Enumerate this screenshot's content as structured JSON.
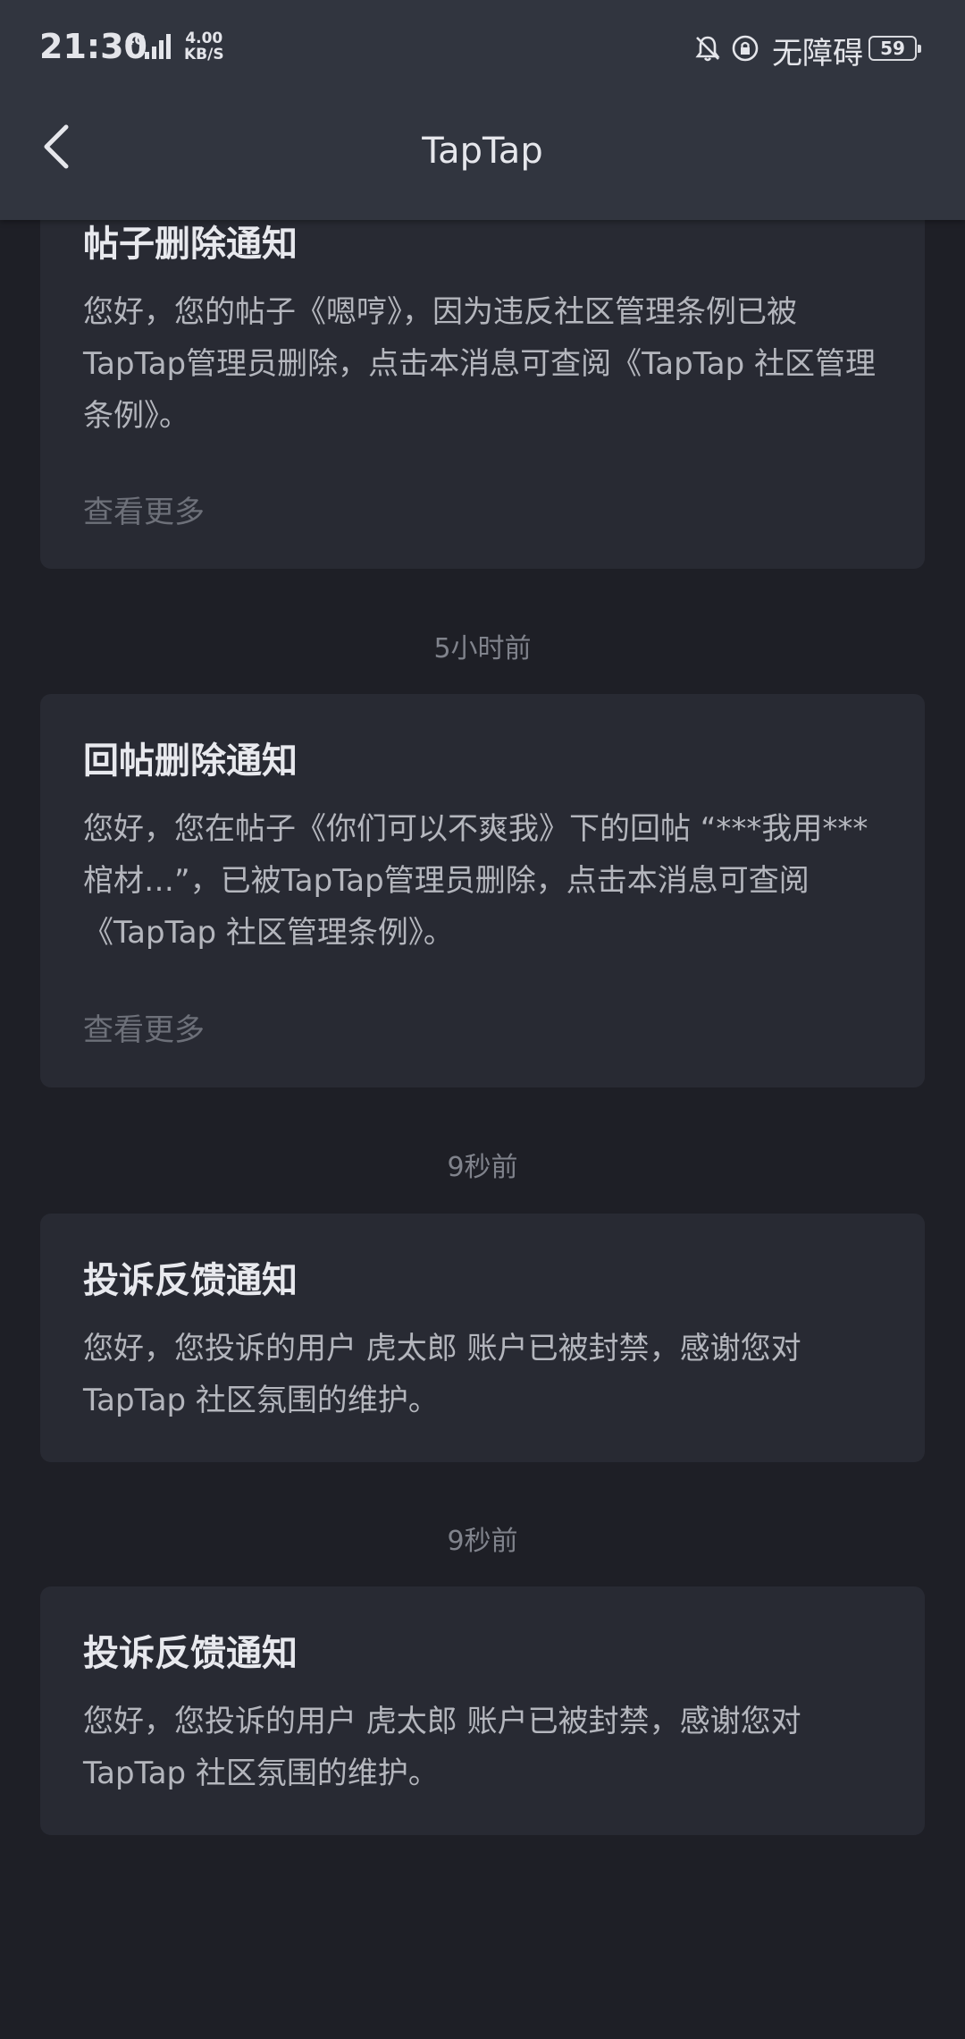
{
  "status_bar": {
    "time": "21:30",
    "network": "4G",
    "speed_value": "4.00",
    "speed_unit": "KB/S",
    "accessibility": "无障碍",
    "battery": "59",
    "icons": [
      "signal-icon",
      "bell-off-icon",
      "rotation-lock-icon",
      "battery-icon"
    ]
  },
  "nav": {
    "title": "TapTap",
    "back_icon": "chevron-left-icon"
  },
  "notifications": [
    {
      "title": "帖子删除通知",
      "body": "您好，您的帖子《嗯哼》，因为违反社区管理条例已被TapTap管理员删除，点击本消息可查阅《TapTap 社区管理条例》。",
      "more": "查看更多"
    },
    {
      "timestamp": "5小时前",
      "title": "回帖删除通知",
      "body": "您好，您在帖子《你们可以不爽我》下的回帖 “***我用***棺材…”，已被TapTap管理员删除，点击本消息可查阅《TapTap 社区管理条例》。",
      "more": "查看更多"
    },
    {
      "timestamp": "9秒前",
      "title": "投诉反馈通知",
      "body": "您好，您投诉的用户 虎太郎 账户已被封禁，感谢您对 TapTap 社区氛围的维护。"
    },
    {
      "timestamp": "9秒前",
      "title": "投诉反馈通知",
      "body": "您好，您投诉的用户 虎太郎 账户已被封禁，感谢您对 TapTap 社区氛围的维护。"
    }
  ],
  "colors": {
    "background": "#1e1f26",
    "card": "#282a33",
    "header": "#31353f"
  }
}
